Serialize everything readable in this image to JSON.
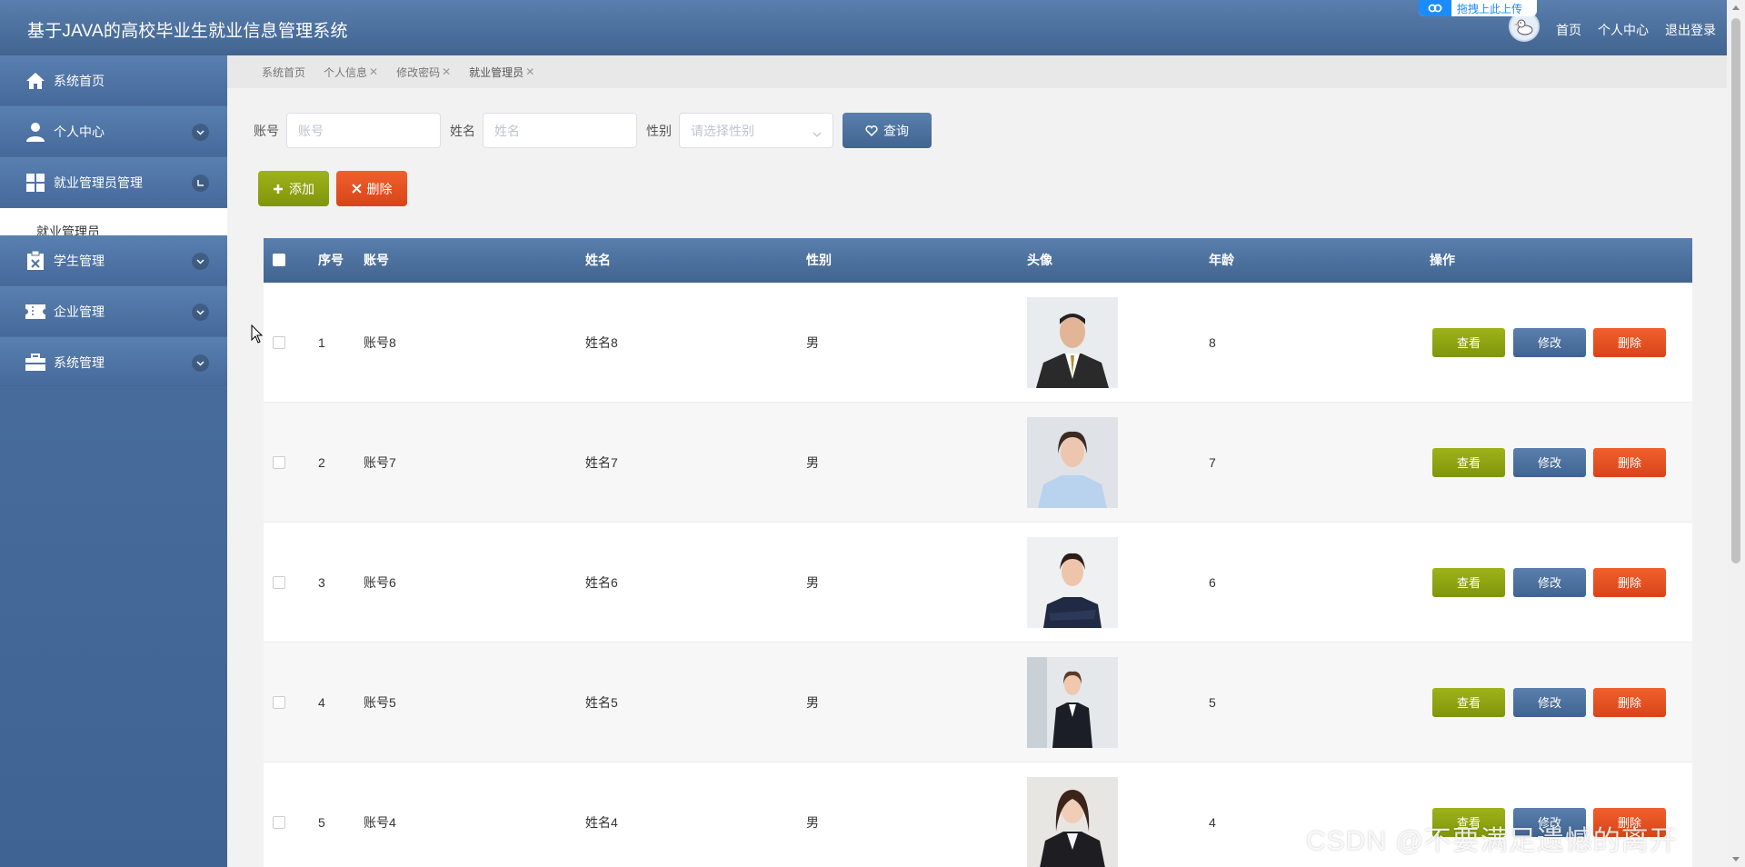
{
  "header": {
    "title": "基于JAVA的高校毕业生就业信息管理系统",
    "upload_badge": "拖拽上此上传",
    "nav": [
      "首页",
      "个人中心",
      "退出登录"
    ]
  },
  "sidebar": {
    "items": [
      {
        "label": "系统首页",
        "icon": "home-icon"
      },
      {
        "label": "个人中心",
        "icon": "user-icon",
        "chevron": "down"
      },
      {
        "label": "就业管理员管理",
        "icon": "grid-icon",
        "chevron": "up"
      },
      {
        "label": "学生管理",
        "icon": "clipboard-icon",
        "chevron": "down"
      },
      {
        "label": "企业管理",
        "icon": "ticket-icon",
        "chevron": "down"
      },
      {
        "label": "系统管理",
        "icon": "briefcase-icon",
        "chevron": "down"
      }
    ],
    "submenu": "就业管理员"
  },
  "tabs": [
    {
      "label": "系统首页",
      "closable": false
    },
    {
      "label": "个人信息",
      "closable": true
    },
    {
      "label": "修改密码",
      "closable": true
    },
    {
      "label": "就业管理员",
      "closable": true
    }
  ],
  "search": {
    "account_label": "账号",
    "account_placeholder": "账号",
    "name_label": "姓名",
    "name_placeholder": "姓名",
    "gender_label": "性别",
    "gender_placeholder": "请选择性别",
    "query_button": "查询"
  },
  "actions": {
    "add": "添加",
    "delete": "删除"
  },
  "table": {
    "headers": [
      "序号",
      "账号",
      "姓名",
      "性别",
      "头像",
      "年龄",
      "操作"
    ],
    "rows": [
      {
        "index": "1",
        "account": "账号8",
        "name": "姓名8",
        "gender": "男",
        "age": "8"
      },
      {
        "index": "2",
        "account": "账号7",
        "name": "姓名7",
        "gender": "男",
        "age": "7"
      },
      {
        "index": "3",
        "account": "账号6",
        "name": "姓名6",
        "gender": "男",
        "age": "6"
      },
      {
        "index": "4",
        "account": "账号5",
        "name": "姓名5",
        "gender": "男",
        "age": "5"
      },
      {
        "index": "5",
        "account": "账号4",
        "name": "姓名4",
        "gender": "男",
        "age": "4"
      }
    ],
    "row_actions": {
      "view": "查看",
      "edit": "修改",
      "delete": "删除"
    }
  },
  "watermark": "CSDN @不要满足遗憾的离开",
  "colors": {
    "primary": "#4d73a3",
    "add": "#8da512",
    "danger": "#e4502a"
  }
}
